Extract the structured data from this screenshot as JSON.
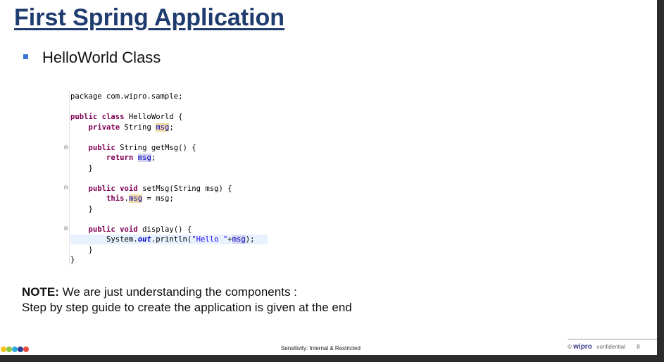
{
  "slide": {
    "title": "First Spring Application",
    "bullet": "HelloWorld Class",
    "code": {
      "l1": "package com.wipro.sample;",
      "l2_kw": "public class",
      "l2_rest": " HelloWorld {",
      "l3_kw": "private",
      "l3_type": " String ",
      "l3_fld": "msg",
      "l3_end": ";",
      "l4_kw": "public",
      "l4_rest": " String getMsg() {",
      "l5_kw": "return",
      "l5_fld": "msg",
      "l5_end": ";",
      "close": "}",
      "l7_kw": "public void",
      "l7_rest": " setMsg(String msg) {",
      "l8_kw": "this",
      "l8_dot": ".",
      "l8_fld": "msg",
      "l8_end": " = msg;",
      "l10_kw": "public void",
      "l10_rest": " display() {",
      "l11_a": "System.",
      "l11_out": "out",
      "l11_b": ".println(",
      "l11_str": "\"Hello \"",
      "l11_plus": "+",
      "l11_fld": "msg",
      "l11_end": ");"
    },
    "note_label": "NOTE:",
    "note_text": " We are just understanding the components :",
    "note_line2": "Step by step guide to create the application is given at the end"
  },
  "footer": {
    "sensitivity": "Sensitivity: Internal & Restricted",
    "copyright": "©",
    "brand": "wipro",
    "confidential": "confidential",
    "page_number": "8",
    "dot_colors": [
      "#f2c41b",
      "#8dc63f",
      "#2fa9d9",
      "#2c3e96",
      "#e94b3c"
    ]
  }
}
